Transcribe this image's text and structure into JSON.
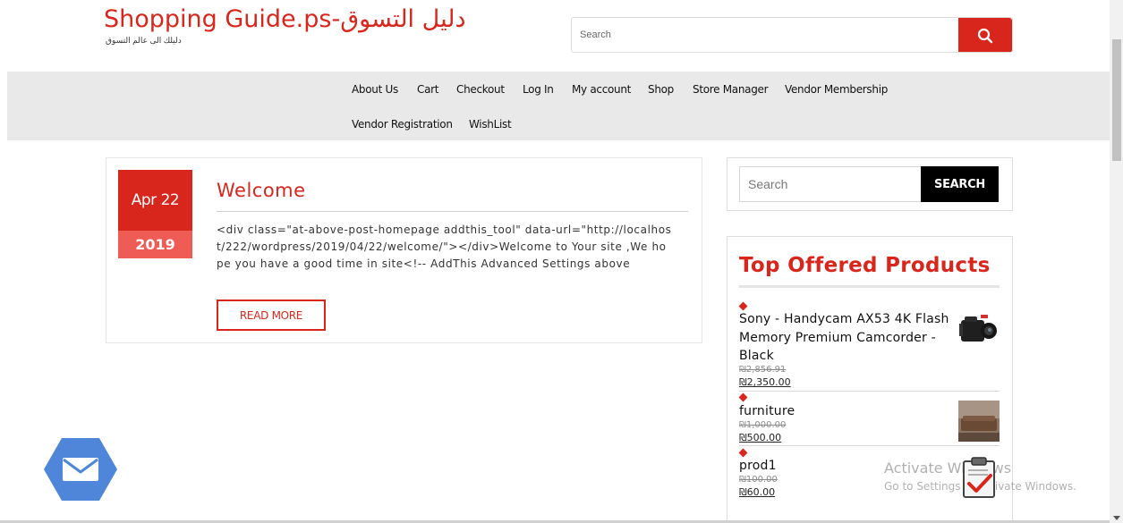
{
  "header": {
    "site_title": "Shopping Guide.ps-دليل التسوق",
    "tagline": "دليلك الى عالم التسوق",
    "search_placeholder": "Search",
    "search_icon": "search-icon"
  },
  "nav": {
    "items": [
      {
        "label": "About Us"
      },
      {
        "label": "Cart"
      },
      {
        "label": "Checkout"
      },
      {
        "label": "Log In"
      },
      {
        "label": "My account"
      },
      {
        "label": "Shop"
      },
      {
        "label": "Store Manager"
      },
      {
        "label": "Vendor Membership"
      },
      {
        "label": "Vendor Registration"
      },
      {
        "label": "WishList"
      }
    ]
  },
  "post": {
    "date_month_day": "Apr 22",
    "date_year": "2019",
    "title": "Welcome",
    "excerpt": "<div class=\"at-above-post-homepage addthis_tool\" data-url=\"http://localhost/222/wordpress/2019/04/22/welcome/\"></div>Welcome to Your site ,We hope you have a good time in site<!-- AddThis Advanced Settings above",
    "read_more_label": "READ MORE"
  },
  "sidebar": {
    "search_placeholder": "Search",
    "search_button_label": "SEARCH",
    "products_widget": {
      "title": "Top Offered Products",
      "items": [
        {
          "name": "Sony - Handycam AX53 4K Flash Memory Premium Camcorder - Black",
          "old_price": "₪2,856.91",
          "new_price": "₪2,350.00"
        },
        {
          "name": "furniture",
          "old_price": "₪1,000.00",
          "new_price": "₪500.00"
        },
        {
          "name": "prod1",
          "old_price": "₪100.00",
          "new_price": "₪60.00"
        }
      ]
    }
  },
  "watermark": {
    "title": "Activate Windows",
    "subtitle": "Go to Settings to activate Windows."
  },
  "colors": {
    "accent": "#d9261c",
    "accent_light": "#ef5b55",
    "nav_bg": "#e9e9e9",
    "fab": "#4f86d9"
  }
}
